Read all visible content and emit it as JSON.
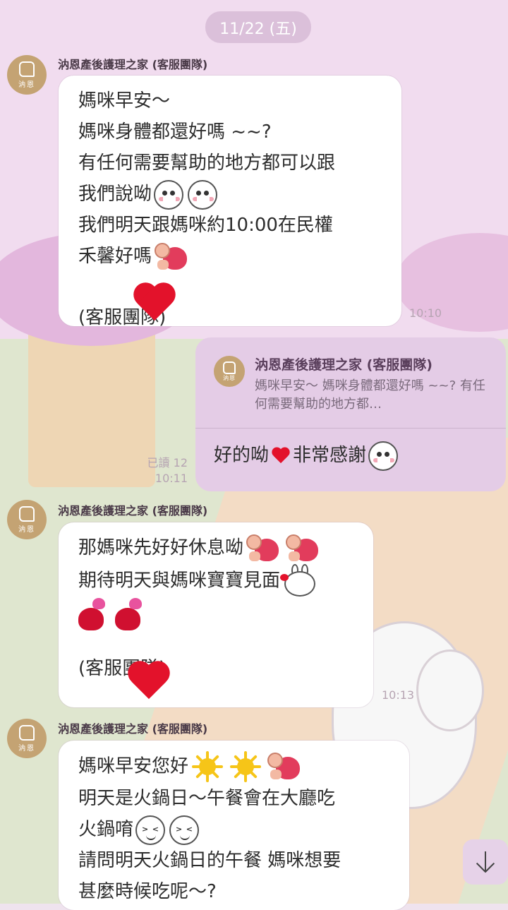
{
  "date_label": "11/22 (五)",
  "sender_name": "汭恩產後護理之家 (客服團隊)",
  "avatar_text": "汭恩",
  "messages": [
    {
      "lines": [
        "媽咪早安～",
        "媽咪身體都還好嗎 ~~?",
        "有任何需要幫助的地方都可以跟",
        "我們說呦",
        "我們明天跟媽咪約10:00在民權",
        "禾馨好嗎"
      ],
      "signature": "(客服團隊)",
      "time": "10:10"
    },
    {
      "lines": [
        "那媽咪先好好休息呦",
        "期待明天與媽咪寶寶見面"
      ],
      "signature": "(客服團隊)",
      "time": "10:13"
    },
    {
      "lines": [
        "媽咪早安您好",
        "明天是火鍋日～午餐會在大廳吃",
        "火鍋唷",
        "請問明天火鍋日的午餐 媽咪想要",
        "甚麼時候吃呢～?"
      ]
    }
  ],
  "reply": {
    "quoted_sender": "汭恩產後護理之家 (客服團隊)",
    "quoted_text": "媽咪早安～ 媽咪身體都還好嗎 ~~? 有任何需要幫助的地方都…",
    "text_before": "好的呦",
    "text_after": "非常感謝",
    "read_label": "已讀 12",
    "time": "10:11"
  },
  "colors": {
    "bubble_incoming": "#ffffff",
    "bubble_outgoing": "#e4cce6",
    "avatar": "#c4a373",
    "heart": "#e3122b"
  },
  "icons": {
    "scroll_down": "arrow-down-icon",
    "stickers": [
      "smile-face-icon",
      "hug-heart-icon",
      "red-heart-icon",
      "bunny-kiss-icon",
      "double-heart-icon",
      "sun-icon",
      "laugh-face-icon"
    ]
  }
}
